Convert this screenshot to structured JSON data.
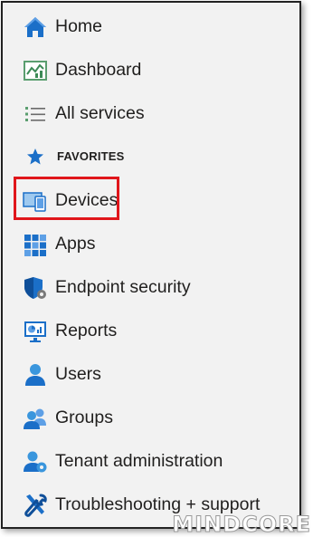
{
  "nav": {
    "items": [
      {
        "label": "Home",
        "icon": "home-icon"
      },
      {
        "label": "Dashboard",
        "icon": "dashboard-icon"
      },
      {
        "label": "All services",
        "icon": "list-icon"
      }
    ],
    "favorites_header": "FAVORITES",
    "favorites": [
      {
        "label": "Devices",
        "icon": "devices-icon"
      },
      {
        "label": "Apps",
        "icon": "apps-grid-icon"
      },
      {
        "label": "Endpoint security",
        "icon": "shield-gear-icon"
      },
      {
        "label": "Reports",
        "icon": "reports-monitor-icon"
      },
      {
        "label": "Users",
        "icon": "user-icon"
      },
      {
        "label": "Groups",
        "icon": "groups-icon"
      },
      {
        "label": "Tenant administration",
        "icon": "tenant-admin-icon"
      },
      {
        "label": "Troubleshooting + support",
        "icon": "tools-icon"
      }
    ]
  },
  "highlight_color": "#e0161b",
  "accent_color": "#0078d4",
  "watermark": "MINDCORE"
}
